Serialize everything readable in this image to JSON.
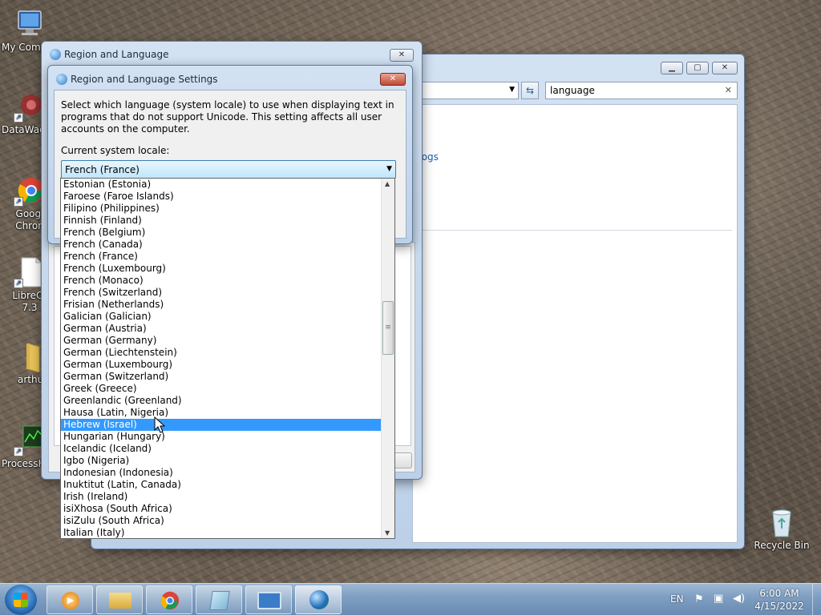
{
  "desktop": {
    "icons": [
      {
        "label": "My Comp",
        "icon": "computer-icon"
      },
      {
        "label": "DataWag",
        "icon": "datawag-icon"
      },
      {
        "label": "Googl Chron",
        "icon": "chrome-icon"
      },
      {
        "label": "LibreOf 7.3",
        "icon": "libreoffice-icon"
      },
      {
        "label": "arthu",
        "icon": "folder-icon"
      },
      {
        "label": "ProcessH",
        "icon": "processhacker-icon"
      },
      {
        "label": "Recycle Bin",
        "icon": "recycle-bin-icon"
      }
    ]
  },
  "control_panel": {
    "search_value": "language",
    "link_fragment": "alogs"
  },
  "region_window": {
    "title": "Region and Language"
  },
  "settings_dialog": {
    "title": "Region and Language Settings",
    "description": "Select which language (system locale) to use when displaying text in programs that do not support Unicode. This setting affects all user accounts on the computer.",
    "locale_label": "Current system locale:",
    "selected_locale": "French (France)",
    "highlighted_item": "Hebrew (Israel)",
    "locale_options": [
      "Estonian (Estonia)",
      "Faroese (Faroe Islands)",
      "Filipino (Philippines)",
      "Finnish (Finland)",
      "French (Belgium)",
      "French (Canada)",
      "French (France)",
      "French (Luxembourg)",
      "French (Monaco)",
      "French (Switzerland)",
      "Frisian (Netherlands)",
      "Galician (Galician)",
      "German (Austria)",
      "German (Germany)",
      "German (Liechtenstein)",
      "German (Luxembourg)",
      "German (Switzerland)",
      "Greek (Greece)",
      "Greenlandic (Greenland)",
      "Hausa (Latin, Nigeria)",
      "Hebrew (Israel)",
      "Hungarian (Hungary)",
      "Icelandic (Iceland)",
      "Igbo (Nigeria)",
      "Indonesian (Indonesia)",
      "Inuktitut (Latin, Canada)",
      "Irish (Ireland)",
      "isiXhosa (South Africa)",
      "isiZulu (South Africa)",
      "Italian (Italy)"
    ]
  },
  "taskbar": {
    "apps": [
      "windows-media-player-icon",
      "file-explorer-icon",
      "chrome-icon",
      "notepad-icon",
      "control-panel-icon",
      "region-language-icon"
    ],
    "language": "EN",
    "time": "6:00 AM",
    "date": "4/15/2022"
  }
}
